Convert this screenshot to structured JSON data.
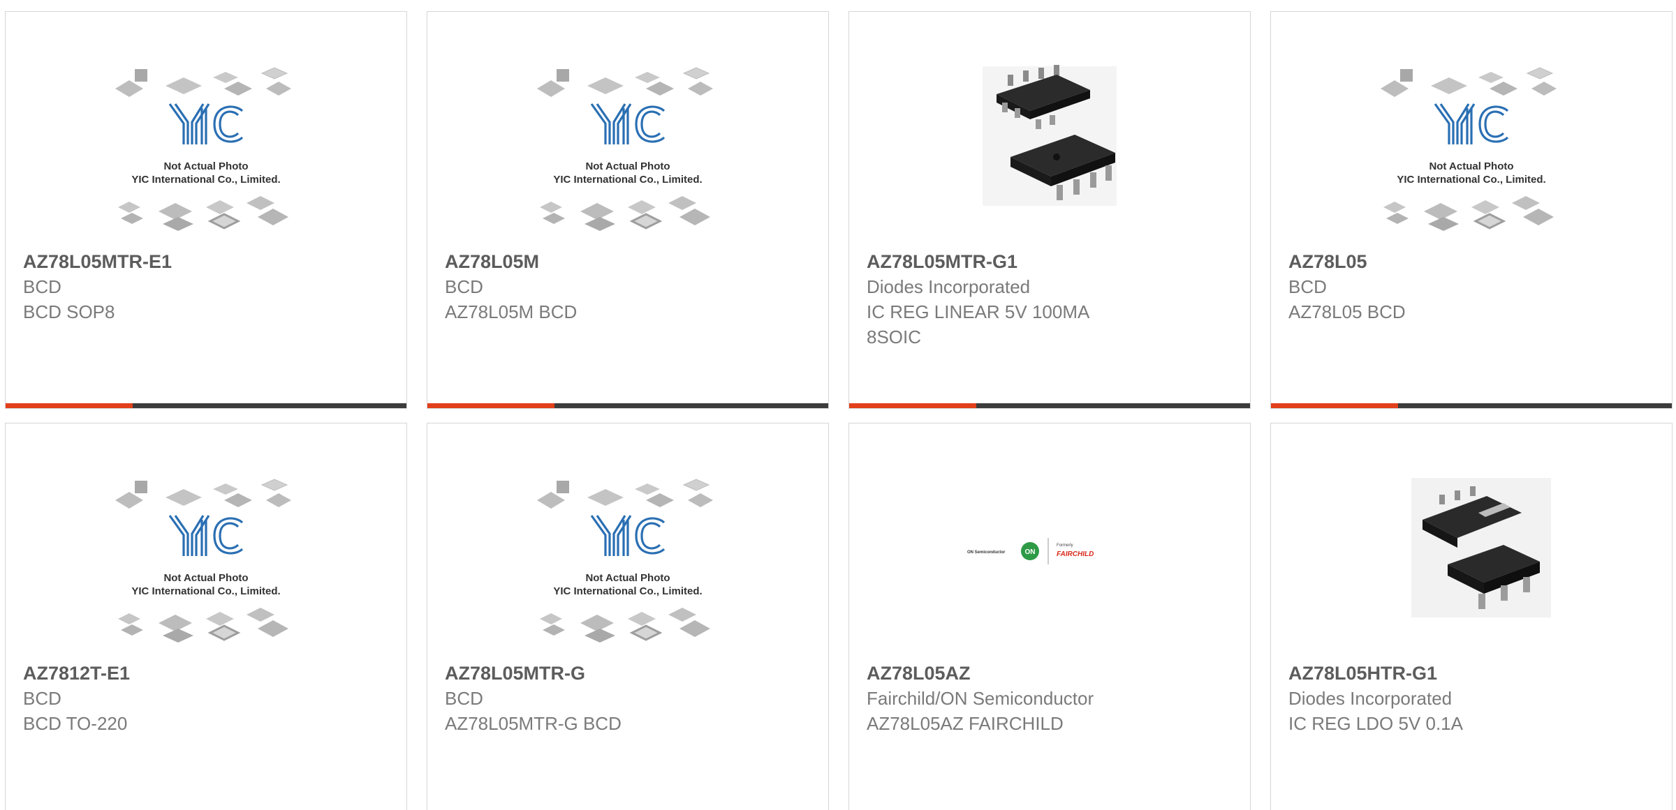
{
  "colors": {
    "accent": "#e1401b",
    "bar": "#3c3c3c",
    "border": "#d6d6d6",
    "part_text": "#5c5c5c",
    "sub_text": "#7a7a7a",
    "yic_blue": "#2a6fb3"
  },
  "placeholder": {
    "line1": "Not Actual Photo",
    "line2": "YIC International Co., Limited."
  },
  "fairchild_logo": {
    "on_semi": "ON Semiconductor",
    "on": "ON",
    "formerly": "Formerly",
    "fairchild": "FAIRCHILD"
  },
  "products": [
    {
      "part": "AZ78L05MTR-E1",
      "manufacturer": "BCD",
      "description": "BCD SOP8",
      "image": "yic-placeholder"
    },
    {
      "part": "AZ78L05M",
      "manufacturer": "BCD",
      "description": "AZ78L05M BCD",
      "image": "yic-placeholder"
    },
    {
      "part": "AZ78L05MTR-G1",
      "manufacturer": "Diodes Incorporated",
      "description": "IC REG LINEAR 5V 100MA\n8SOIC",
      "image": "soic8-chip"
    },
    {
      "part": "AZ78L05",
      "manufacturer": "BCD",
      "description": "AZ78L05 BCD",
      "image": "yic-placeholder"
    },
    {
      "part": "AZ7812T-E1",
      "manufacturer": "BCD",
      "description": "BCD TO-220",
      "image": "yic-placeholder"
    },
    {
      "part": "AZ78L05MTR-G",
      "manufacturer": "BCD",
      "description": "AZ78L05MTR-G BCD",
      "image": "yic-placeholder"
    },
    {
      "part": "AZ78L05AZ",
      "manufacturer": "Fairchild/ON Semiconductor",
      "description": "AZ78L05AZ FAIRCHILD",
      "image": "fairchild-logo"
    },
    {
      "part": "AZ78L05HTR-G1",
      "manufacturer": "Diodes Incorporated",
      "description": "IC REG LDO 5V 0.1A",
      "image": "sot223-chip"
    }
  ]
}
